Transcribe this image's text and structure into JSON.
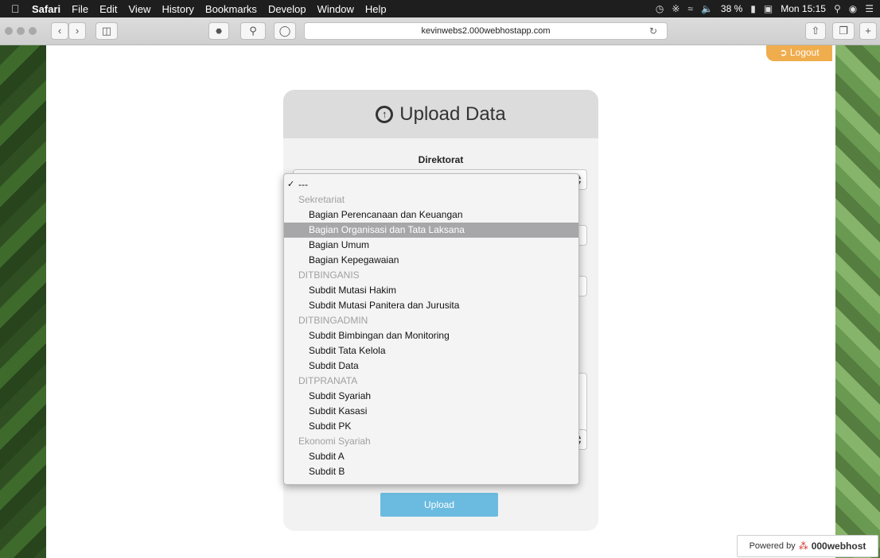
{
  "menubar": {
    "app": "Safari",
    "items": [
      "File",
      "Edit",
      "View",
      "History",
      "Bookmarks",
      "Develop",
      "Window",
      "Help"
    ],
    "battery": "38 %",
    "clock": "Mon 15:15"
  },
  "browser": {
    "url": "kevinwebs2.000webhostapp.com"
  },
  "header": {
    "logout_label": "Logout"
  },
  "form": {
    "title": "Upload Data",
    "direktorat_label": "Direktorat",
    "upload_label": "Upload"
  },
  "dropdown": {
    "options": [
      {
        "type": "checked",
        "label": "---"
      },
      {
        "type": "group",
        "label": "Sekretariat"
      },
      {
        "type": "item",
        "label": "Bagian Perencanaan dan Keuangan"
      },
      {
        "type": "item",
        "label": "Bagian Organisasi dan Tata Laksana",
        "highlight": true
      },
      {
        "type": "item",
        "label": "Bagian Umum"
      },
      {
        "type": "item",
        "label": "Bagian Kepegawaian"
      },
      {
        "type": "group",
        "label": "DITBINGANIS"
      },
      {
        "type": "item",
        "label": "Subdit Mutasi Hakim"
      },
      {
        "type": "item",
        "label": "Subdit Mutasi Panitera dan Jurusita"
      },
      {
        "type": "group",
        "label": "DITBINGADMIN"
      },
      {
        "type": "item",
        "label": "Subdit Bimbingan dan Monitoring"
      },
      {
        "type": "item",
        "label": "Subdit Tata Kelola"
      },
      {
        "type": "item",
        "label": "Subdit Data"
      },
      {
        "type": "group",
        "label": "DITPRANATA"
      },
      {
        "type": "item",
        "label": "Subdit Syariah"
      },
      {
        "type": "item",
        "label": "Subdit Kasasi"
      },
      {
        "type": "item",
        "label": "Subdit PK"
      },
      {
        "type": "group",
        "label": "Ekonomi Syariah"
      },
      {
        "type": "item",
        "label": "Subdit A"
      },
      {
        "type": "item",
        "label": "Subdit B"
      }
    ]
  },
  "footer": {
    "powered_prefix": "Powered by",
    "powered_brand": "000webhost"
  },
  "colors": {
    "logout": "#f0ad4e",
    "upload": "#6bbbe0",
    "highlight": "#a7a7aa"
  }
}
